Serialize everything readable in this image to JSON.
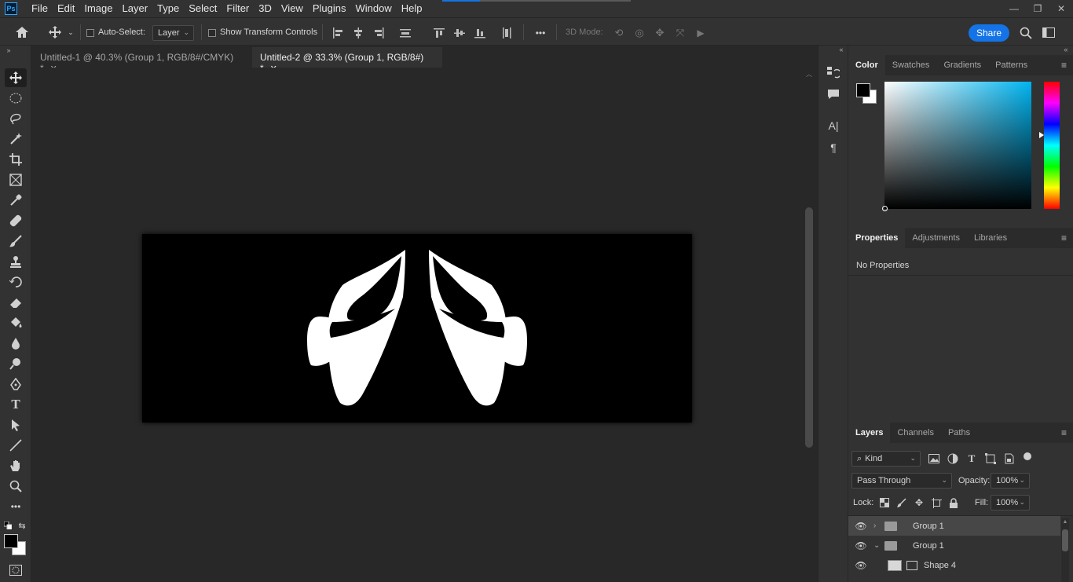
{
  "app": {
    "logo_text": "Ps",
    "menu": [
      "File",
      "Edit",
      "Image",
      "Layer",
      "Type",
      "Select",
      "Filter",
      "3D",
      "View",
      "Plugins",
      "Window",
      "Help"
    ],
    "window_controls": {
      "minimize": "—",
      "restore": "❐",
      "close": "✕"
    }
  },
  "options_bar": {
    "auto_select_label": "Auto-Select:",
    "auto_select_target": "Layer",
    "show_transform_label": "Show Transform Controls",
    "mode_3d_label": "3D Mode:",
    "share_label": "Share",
    "more_glyph": "•••"
  },
  "tabs": [
    {
      "title": "Untitled-1 @ 40.3% (Group 1, RGB/8#/CMYK) *",
      "close": "✕",
      "active": false
    },
    {
      "title": "Untitled-2 @ 33.3% (Group 1, RGB/8#) *",
      "close": "✕",
      "active": true
    }
  ],
  "color_panel": {
    "tabs": [
      "Color",
      "Swatches",
      "Gradients",
      "Patterns"
    ],
    "foreground": "#000000",
    "background": "#ffffff",
    "hue_color": "#00b4f0"
  },
  "properties_panel": {
    "tabs": [
      "Properties",
      "Adjustments",
      "Libraries"
    ],
    "empty_text": "No Properties"
  },
  "layers_panel": {
    "tabs": [
      "Layers",
      "Channels",
      "Paths"
    ],
    "filter_kind": "Kind",
    "blend_mode": "Pass Through",
    "opacity_label": "Opacity:",
    "opacity_value": "100%",
    "lock_label": "Lock:",
    "fill_label": "Fill:",
    "fill_value": "100%",
    "layers": [
      {
        "name": "Group 1",
        "type": "group",
        "expanded": false,
        "selected": true
      },
      {
        "name": "Group 1",
        "type": "group",
        "expanded": true,
        "selected": false
      },
      {
        "name": "Shape 4",
        "type": "shape",
        "selected": false
      }
    ]
  }
}
